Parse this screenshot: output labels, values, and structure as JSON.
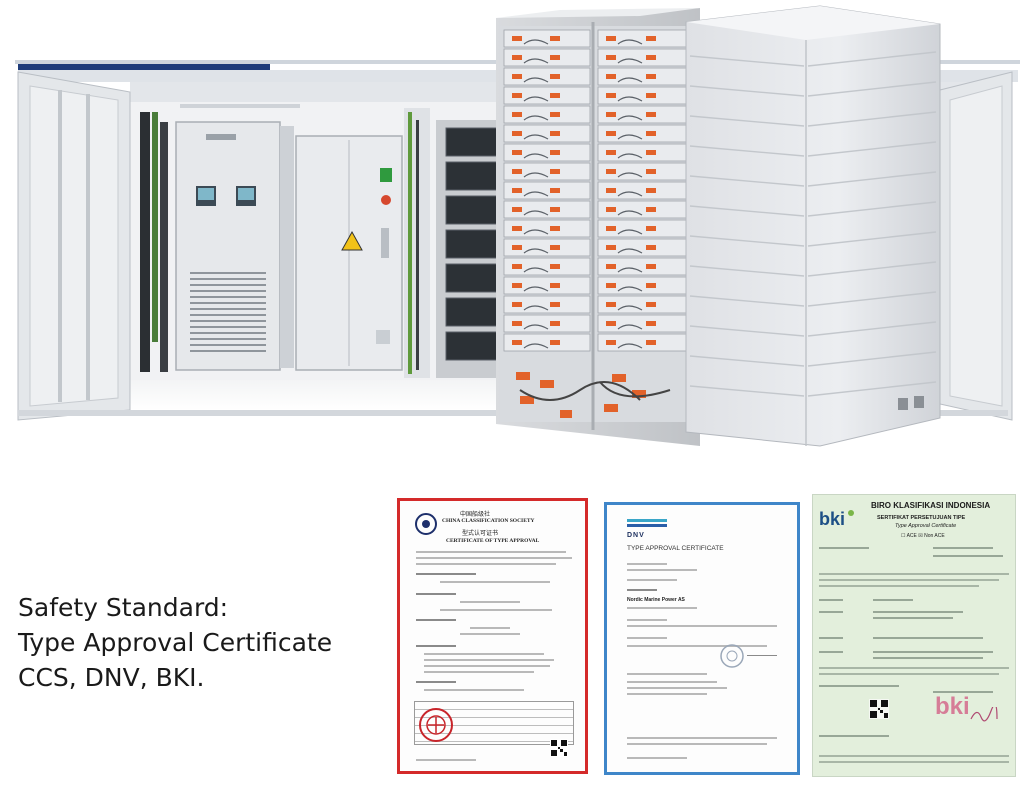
{
  "caption": {
    "line1": "Safety Standard:",
    "line2": "Type Approval Certificate",
    "line3": "CCS, DNV, BKI."
  },
  "certificates": {
    "ccs": {
      "org_cn": "中国船级社",
      "org_en": "CHINA CLASSIFICATION SOCIETY",
      "title_cn": "型式认可证书",
      "title_en": "CERTIFICATE OF TYPE APPROVAL",
      "frame_color": "#d42a2a"
    },
    "dnv": {
      "logo": "DNV",
      "title": "TYPE APPROVAL CERTIFICATE",
      "holder": "Nordic Marine Power AS",
      "frame_color": "#3f86c9"
    },
    "bki": {
      "logo": "bki",
      "org": "BIRO KLASIFIKASI INDONESIA",
      "title_id": "SERTIFIKAT PERSETUJUAN TIPE",
      "title_en": "Type Approval Certificate",
      "options": "☐ ACE ☒ Non ACE",
      "stamp": "bki"
    }
  },
  "colors": {
    "container_shell": "#e9ecef",
    "container_stripe": "#1f3c7a",
    "battery_module_orange": "#e2622a",
    "bki_paper": "#e3efdc"
  }
}
